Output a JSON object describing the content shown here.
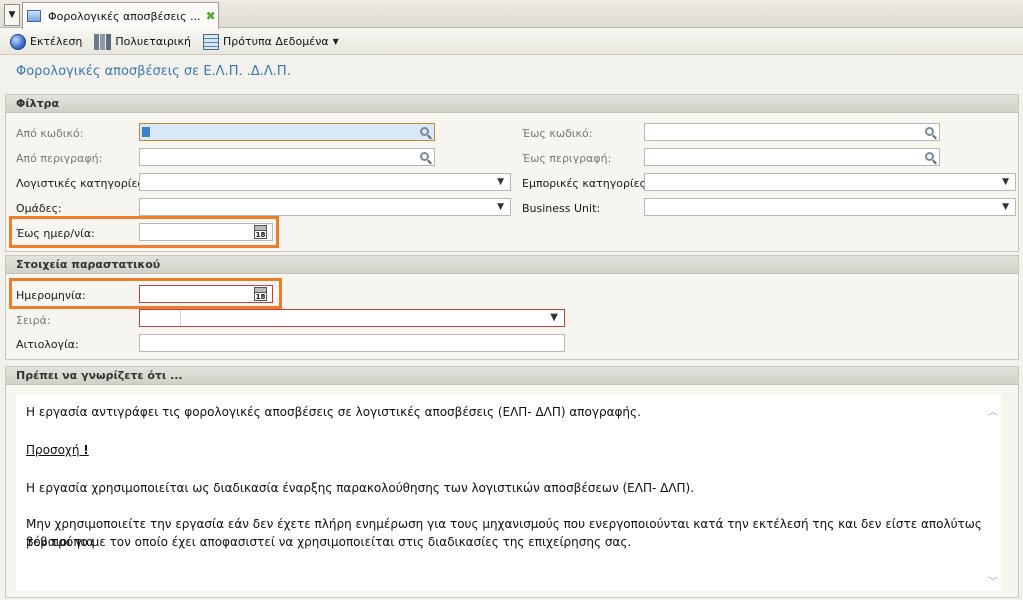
{
  "tab": {
    "label": "Φορολογικές αποσβέσεις ...",
    "close_symbol": "✖"
  },
  "toolbar": {
    "run_label": "Εκτέλεση",
    "company_label": "Πολυεταιρική",
    "templates_label": "Πρότυπα Δεδομένα",
    "dropdown_symbol": "▼"
  },
  "page": {
    "title": "Φορολογικές αποσβέσεις σε Ε.Λ.Π. .Δ.Λ.Π."
  },
  "filters": {
    "header": "Φίλτρα",
    "from_code_label": "Από κωδικό:",
    "to_code_label": "Έως κωδικό:",
    "from_desc_label": "Από περιγραφή:",
    "to_desc_label": "Έως περιγραφή:",
    "accounting_categories_label": "Λογιστικές κατηγορίες:",
    "commercial_categories_label": "Εμπορικές κατηγορίες:",
    "groups_label": "Ομάδες:",
    "business_unit_label": "Business Unit:",
    "to_date_label": "Έως ημερ/νία:"
  },
  "document": {
    "header": "Στοιχεία παραστατικού",
    "date_label": "Ημερομηνία:",
    "series_label": "Σειρά:",
    "reason_label": "Αιτιολογία:"
  },
  "notice": {
    "header": "Πρέπει να γνωρίζετε ότι ...",
    "line1": "Η εργασία αντιγράφει τις φορολογικές αποσβέσεις σε λογιστικές αποσβέσεις (ΕΛΠ- ΔΛΠ) απογραφής.",
    "attention": "Προσοχή",
    "attention_mark": "!",
    "line2": "Η εργασία χρησιμοποιείται ως διαδικασία έναρξης παρακολούθησης των λογιστικών αποσβέσεων (ΕΛΠ- ΔΛΠ).",
    "line3a": "Μην χρησιμοποιείτε την εργασία εάν δεν έχετε πλήρη ενημέρωση για τους μηχανισμούς που ενεργοποιούνται κατά την εκτέλεσή της και δεν είστε απολύτως βέβαιοι για",
    "line3b": "τον τρόπο με τον οποίο έχει αποφασιστεί να χρησιμοποιείται στις διαδικασίες της επιχείρησης σας."
  },
  "icons": {
    "calendar_text": "18"
  },
  "colors": {
    "highlight": "#ee7d2a",
    "title": "#3a78b0",
    "attention": "#c0282d"
  }
}
